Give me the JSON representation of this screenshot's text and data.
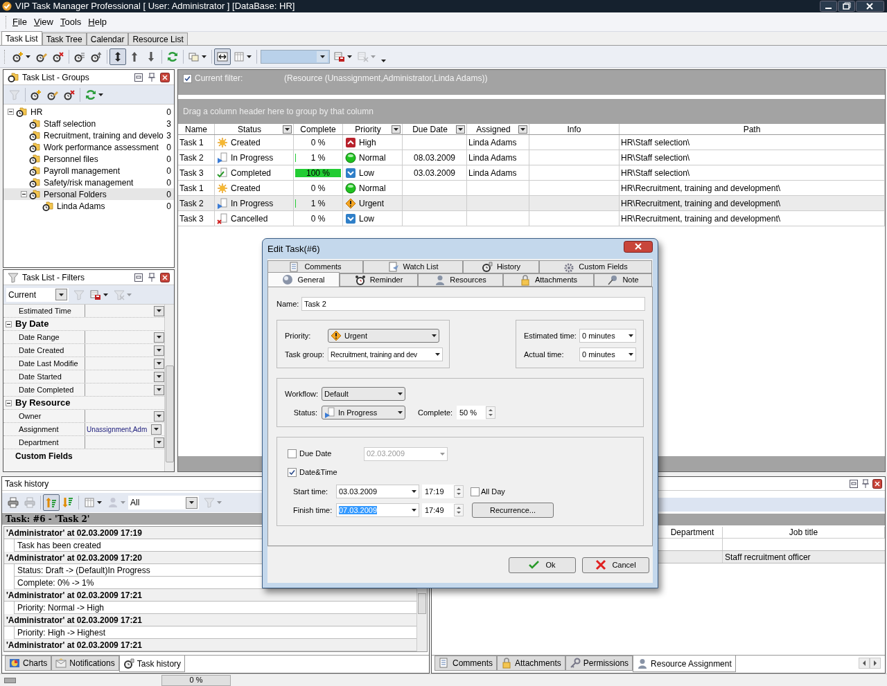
{
  "window": {
    "title": "VIP Task Manager Professional [ User: Administrator ] [DataBase: HR]"
  },
  "menu": [
    "File",
    "View",
    "Tools",
    "Help"
  ],
  "view_tabs": [
    {
      "label": "Task List",
      "selected": true
    },
    {
      "label": "Task Tree",
      "selected": false
    },
    {
      "label": "Calendar",
      "selected": false
    },
    {
      "label": "Resource List",
      "selected": false
    }
  ],
  "toolbar": [
    {
      "kind": "add",
      "pressed": false,
      "menu": true,
      "disabled": false
    },
    {
      "kind": "edit",
      "pressed": false,
      "menu": false,
      "disabled": false
    },
    {
      "kind": "delete",
      "pressed": false,
      "menu": false,
      "disabled": false
    },
    {
      "kind": "separator"
    },
    {
      "kind": "list",
      "pressed": false,
      "menu": false,
      "disabled": false
    },
    {
      "kind": "raise",
      "pressed": false,
      "menu": false,
      "disabled": false
    },
    {
      "kind": "separator"
    },
    {
      "kind": "move",
      "pressed": true,
      "menu": false,
      "disabled": false
    },
    {
      "kind": "up",
      "pressed": false,
      "menu": false,
      "disabled": false
    },
    {
      "kind": "down",
      "pressed": false,
      "menu": false,
      "disabled": false
    },
    {
      "kind": "separator"
    },
    {
      "kind": "refresh",
      "pressed": false,
      "menu": false,
      "disabled": false
    },
    {
      "kind": "separator"
    },
    {
      "kind": "windows",
      "pressed": false,
      "menu": true,
      "disabled": false
    },
    {
      "kind": "separator"
    },
    {
      "kind": "fit",
      "pressed": true,
      "menu": false,
      "disabled": false
    },
    {
      "kind": "columns",
      "pressed": false,
      "menu": true,
      "disabled": false
    },
    {
      "kind": "separator"
    },
    {
      "kind": "combo",
      "pressed": false,
      "menu": true,
      "disabled": false
    },
    {
      "kind": "save",
      "pressed": false,
      "menu": true,
      "disabled": false
    },
    {
      "kind": "grid",
      "pressed": false,
      "menu": true,
      "disabled": true
    },
    {
      "kind": "more",
      "pressed": false,
      "menu": true,
      "disabled": false
    }
  ],
  "groups_panel": {
    "title": "Task List - Groups",
    "toolbar": [
      {
        "kind": "funnel",
        "pressed": false,
        "menu": false,
        "disabled": true
      },
      {
        "kind": "separator"
      },
      {
        "kind": "add",
        "pressed": false,
        "menu": false,
        "disabled": false
      },
      {
        "kind": "edit",
        "pressed": false,
        "menu": false,
        "disabled": false
      },
      {
        "kind": "delete",
        "pressed": false,
        "menu": false,
        "disabled": false
      },
      {
        "kind": "separator"
      },
      {
        "kind": "refresh",
        "pressed": false,
        "menu": true,
        "disabled": false
      }
    ],
    "tree": [
      {
        "label": "HR",
        "count": "0",
        "expanded": true,
        "selected": false,
        "children": [
          {
            "label": "Staff selection",
            "count": "3",
            "selected": false
          },
          {
            "label": "Recruitment, training and develo",
            "count": "3",
            "selected": false
          },
          {
            "label": "Work performance assessment",
            "count": "0",
            "selected": false
          },
          {
            "label": "Personnel files",
            "count": "0",
            "selected": false
          },
          {
            "label": "Payroll management",
            "count": "0",
            "selected": false
          },
          {
            "label": "Safety/risk management",
            "count": "0",
            "selected": false
          },
          {
            "label": "Personal Folders",
            "count": "0",
            "expanded": true,
            "selected": true,
            "children": [
              {
                "label": "Linda  Adams",
                "count": "0",
                "selected": false
              }
            ]
          }
        ]
      }
    ]
  },
  "filters_panel": {
    "title": "Task List - Filters",
    "toolbar": [
      {
        "kind": "select",
        "value": "Current",
        "pressed": false,
        "menu": true,
        "disabled": false
      },
      {
        "kind": "funnel",
        "pressed": false,
        "menu": false,
        "disabled": true
      },
      {
        "kind": "save",
        "pressed": false,
        "menu": true,
        "disabled": false
      },
      {
        "kind": "funnel-x",
        "pressed": false,
        "menu": true,
        "disabled": true
      }
    ],
    "rows": [
      {
        "kind": "field",
        "label": "Estimated Time"
      },
      {
        "kind": "category",
        "label": "By Date",
        "expanded": true
      },
      {
        "kind": "field",
        "label": "Date Range"
      },
      {
        "kind": "field",
        "label": "Date Created"
      },
      {
        "kind": "field",
        "label": "Date Last Modifie"
      },
      {
        "kind": "field",
        "label": "Date Started"
      },
      {
        "kind": "field",
        "label": "Date Completed"
      },
      {
        "kind": "category",
        "label": "By Resource",
        "expanded": true
      },
      {
        "kind": "field",
        "label": "Owner"
      },
      {
        "kind": "field",
        "label": "Assignment",
        "value": "Unassignment,Adm"
      },
      {
        "kind": "field",
        "label": "Department"
      },
      {
        "kind": "section",
        "label": "Custom Fields"
      }
    ]
  },
  "filter_bar": {
    "checked": true,
    "label": "Current filter:",
    "expression": "(Resource  (Unassignment,Administrator,Linda  Adams))"
  },
  "group_hint": "Drag a column header here to group by that column",
  "task_table": {
    "columns": [
      {
        "label": "Name",
        "filter_button": false
      },
      {
        "label": "Status",
        "filter_button": true
      },
      {
        "label": "Complete",
        "filter_button": false
      },
      {
        "label": "Priority",
        "filter_button": true
      },
      {
        "label": "Due Date",
        "filter_button": true
      },
      {
        "label": "Assigned",
        "filter_button": true
      },
      {
        "label": "Info",
        "filter_button": false
      },
      {
        "label": "Path",
        "filter_button": false
      }
    ],
    "rows": [
      {
        "name": "Task 1",
        "status": {
          "kind": "created",
          "label": "Created"
        },
        "complete": "0 %",
        "level": 0,
        "priority": {
          "kind": "high",
          "label": "High"
        },
        "assigned": "Linda  Adams",
        "path": "HR\\Staff selection\\",
        "selected": false
      },
      {
        "name": "Task 2",
        "status": {
          "kind": "in_progress",
          "label": "In Progress"
        },
        "complete": "1 %",
        "level": 0.01,
        "priority": {
          "kind": "normal",
          "label": "Normal"
        },
        "due_date": "08.03.2009",
        "assigned": "Linda  Adams",
        "path": "HR\\Staff selection\\",
        "selected": false
      },
      {
        "name": "Task 3",
        "status": {
          "kind": "completed",
          "label": "Completed"
        },
        "complete": "100 %",
        "level": 1,
        "priority": {
          "kind": "low",
          "label": "Low"
        },
        "due_date": "03.03.2009",
        "assigned": "Linda  Adams",
        "path": "HR\\Staff selection\\",
        "selected": false
      },
      {
        "name": "Task 1",
        "status": {
          "kind": "created",
          "label": "Created"
        },
        "complete": "0 %",
        "level": 0,
        "priority": {
          "kind": "normal",
          "label": "Normal"
        },
        "path": "HR\\Recruitment, training and development\\",
        "selected": false
      },
      {
        "name": "Task 2",
        "status": {
          "kind": "in_progress",
          "label": "In Progress"
        },
        "complete": "1 %",
        "level": 0.01,
        "priority": {
          "kind": "urgent",
          "label": "Urgent"
        },
        "path": "HR\\Recruitment, training and development\\",
        "selected": true
      },
      {
        "name": "Task 3",
        "status": {
          "kind": "cancelled",
          "label": "Cancelled"
        },
        "complete": "0 %",
        "level": 0,
        "priority": {
          "kind": "low",
          "label": "Low"
        },
        "path": "HR\\Recruitment, training and development\\",
        "selected": false
      }
    ]
  },
  "history_panel": {
    "title": "Task history",
    "toolbar": [
      {
        "kind": "print",
        "pressed": false,
        "menu": false,
        "disabled": false
      },
      {
        "kind": "print",
        "pressed": false,
        "menu": false,
        "disabled": true
      },
      {
        "kind": "separator"
      },
      {
        "kind": "sort-asc",
        "pressed": true,
        "menu": false,
        "disabled": false
      },
      {
        "kind": "sort-desc",
        "pressed": false,
        "menu": false,
        "disabled": false
      },
      {
        "kind": "separator"
      },
      {
        "kind": "columns",
        "pressed": false,
        "menu": true,
        "disabled": false
      },
      {
        "kind": "person",
        "pressed": false,
        "menu": true,
        "disabled": true
      },
      {
        "kind": "select",
        "value": "All",
        "pressed": false,
        "menu": true,
        "disabled": false
      },
      {
        "kind": "funnel",
        "pressed": false,
        "menu": true,
        "disabled": true
      }
    ],
    "task": "Task: #6 - 'Task 2'",
    "entries": [
      {
        "header": "'Administrator' at 02.03.2009 17:19",
        "changes": [
          "Task has been created"
        ]
      },
      {
        "header": "'Administrator' at 02.03.2009 17:20",
        "changes": [
          "Status: Draft -> (Default)In Progress",
          "Complete: 0% -> 1%"
        ]
      },
      {
        "header": "'Administrator' at 02.03.2009 17:21",
        "changes": [
          "Priority: Normal -> High"
        ]
      },
      {
        "header": "'Administrator' at 02.03.2009 17:21",
        "changes": [
          "Priority: High -> Highest"
        ]
      },
      {
        "header": "'Administrator' at 02.03.2009 17:21"
      }
    ],
    "tabs": [
      {
        "label": "Charts",
        "kind": "chart",
        "selected": false
      },
      {
        "label": "Notifications",
        "kind": "mail",
        "selected": false
      },
      {
        "label": "Task history",
        "kind": "history",
        "selected": true
      }
    ]
  },
  "resource_panel": {
    "columns": [
      "Department",
      "Job title"
    ],
    "rows": [
      {
        "selected": false
      },
      {
        "job_title": "Staff recruitment officer",
        "selected": true
      }
    ],
    "tabs": [
      {
        "label": "Comments",
        "kind": "comments",
        "selected": false
      },
      {
        "label": "Attachments",
        "kind": "attachments",
        "selected": false
      },
      {
        "label": "Permissions",
        "kind": "permissions",
        "selected": false
      },
      {
        "label": "Resource Assignment",
        "kind": "resources",
        "selected": true
      }
    ]
  },
  "status_bar": {
    "progress": "0 %"
  },
  "dialog": {
    "title": "Edit Task(#6)",
    "tab_rows": [
      {
        "tabs": [
          {
            "label": "Comments",
            "kind": "comments",
            "selected": false
          },
          {
            "label": "Watch List",
            "kind": "watch",
            "selected": false
          },
          {
            "label": "History",
            "kind": "history",
            "selected": false
          },
          {
            "label": "Custom Fields",
            "kind": "custom",
            "selected": false
          }
        ]
      },
      {
        "tabs": [
          {
            "label": "General",
            "kind": "general",
            "selected": true
          },
          {
            "label": "Reminder",
            "kind": "reminder",
            "selected": false
          },
          {
            "label": "Resources",
            "kind": "resources",
            "selected": false
          },
          {
            "label": "Attachments",
            "kind": "attachments",
            "selected": false
          },
          {
            "label": "Note",
            "kind": "note",
            "selected": false
          }
        ]
      }
    ],
    "name": {
      "label": "Name:",
      "value": "Task 2"
    },
    "priority": {
      "label": "Priority:",
      "value": "Urgent",
      "kind": "urgent"
    },
    "task_group": {
      "label": "Task group:",
      "value": "Recruitment, training and dev"
    },
    "estimated_time": {
      "label": "Estimated time:",
      "value": "0 minutes"
    },
    "actual_time": {
      "label": "Actual time:",
      "value": "0 minutes"
    },
    "workflow": {
      "label": "Workflow:",
      "value": "Default"
    },
    "status": {
      "label": "Status:",
      "value": "In Progress",
      "kind": "in_progress"
    },
    "complete": {
      "label": "Complete:",
      "value": "50 %"
    },
    "due_date": {
      "label": "Due Date",
      "checked": false,
      "value": "02.03.2009"
    },
    "date_time": {
      "label": "Date&Time",
      "checked": true
    },
    "start_time": {
      "label": "Start time:",
      "date": "03.03.2009",
      "time": "17:19"
    },
    "all_day": {
      "label": "All Day",
      "checked": false
    },
    "finish_time": {
      "label": "Finish time:",
      "date": "07.03.2009",
      "time": "17:49",
      "text_selected": true
    },
    "recurrence": "Recurrence...",
    "buttons": [
      {
        "label": "Ok",
        "kind": "ok"
      },
      {
        "label": "Cancel",
        "kind": "cancel"
      }
    ]
  }
}
